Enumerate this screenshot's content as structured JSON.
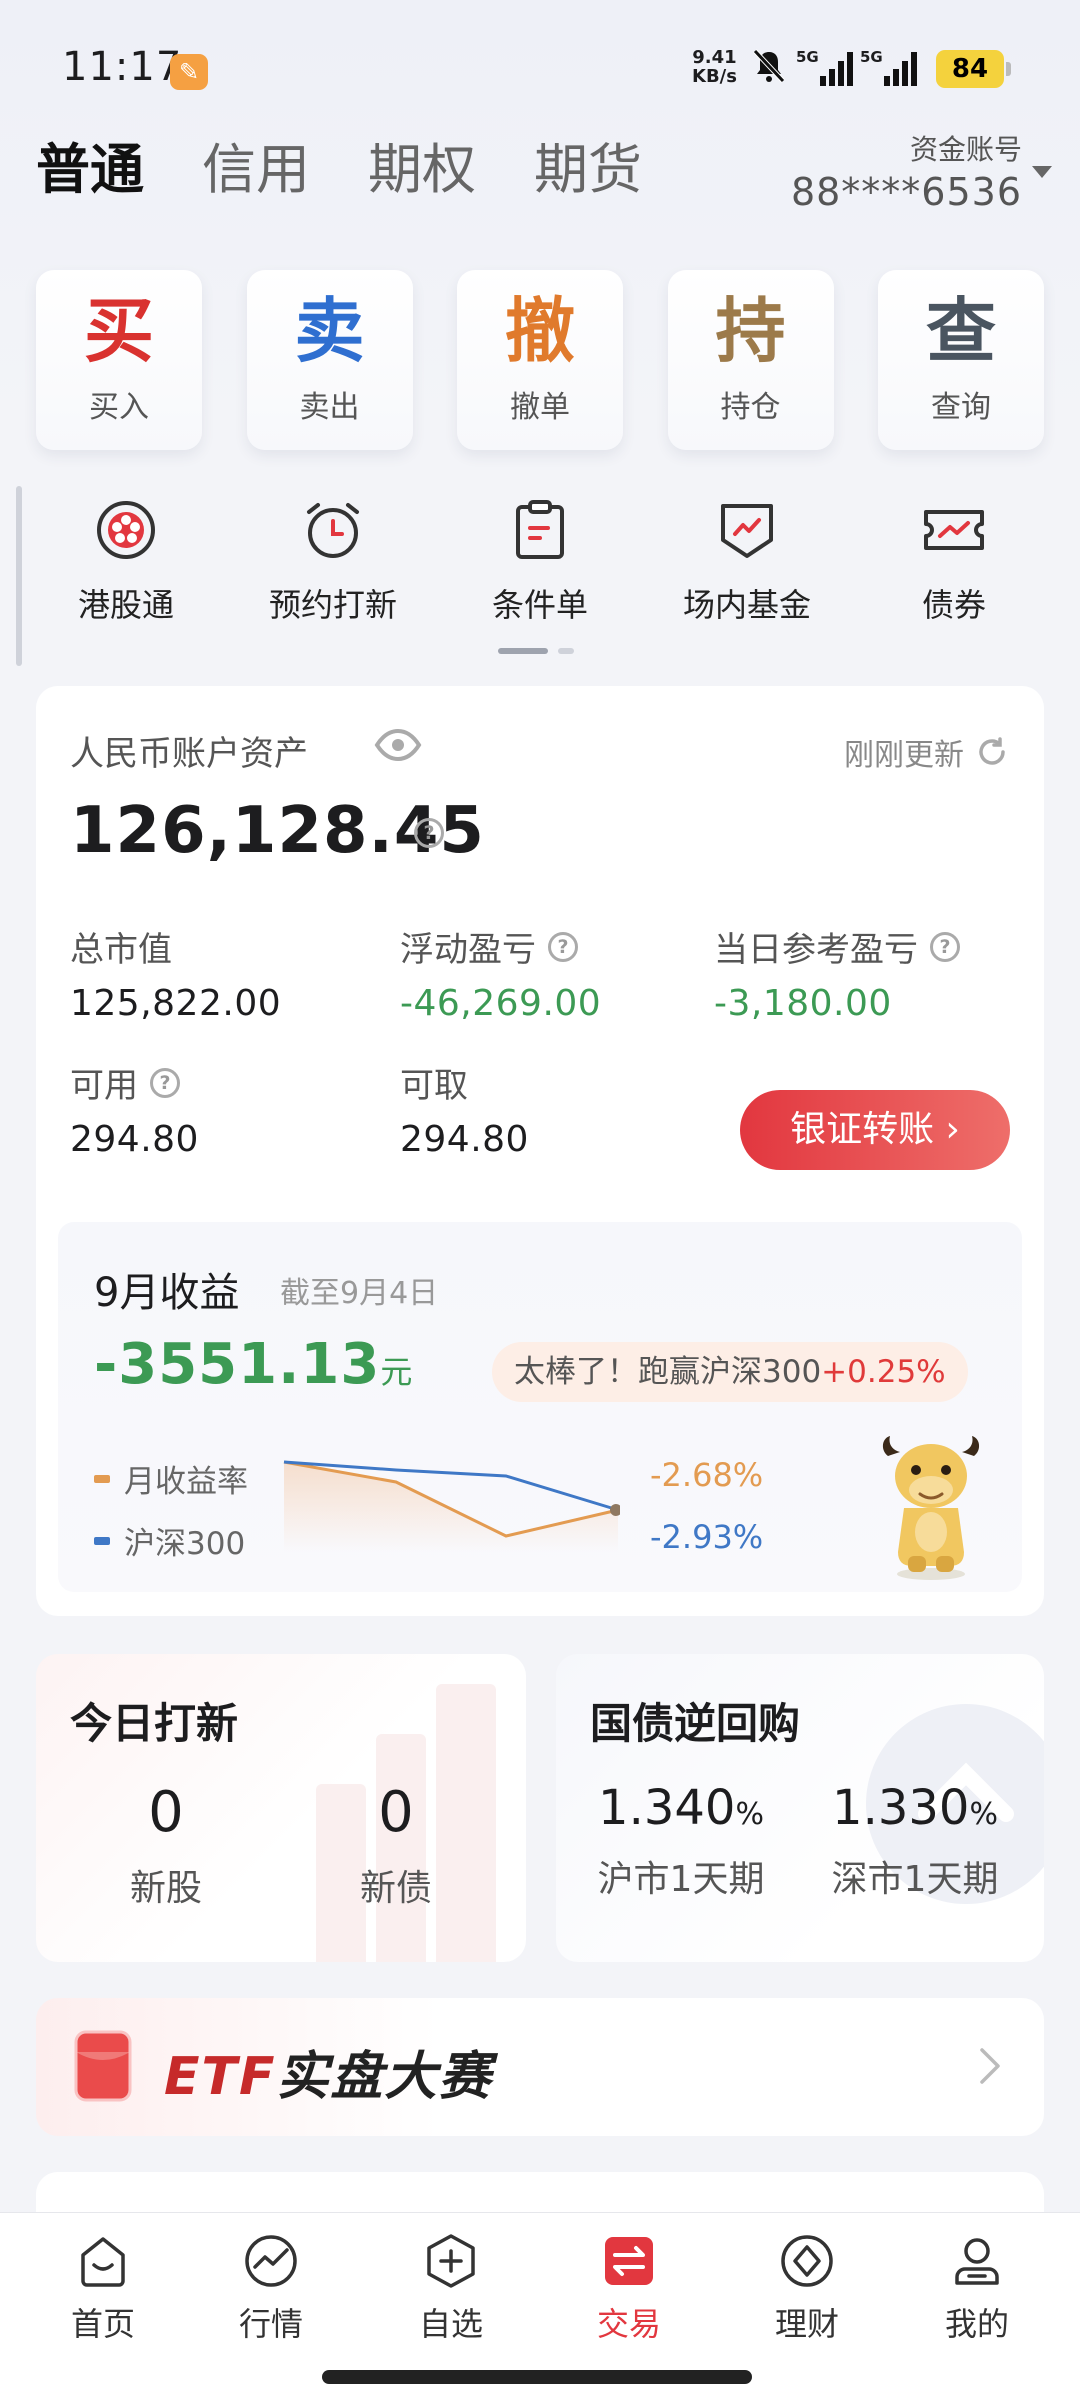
{
  "status_bar": {
    "time": "11:17",
    "app_badge_icon": "app-notification-icon",
    "net_speed_value": "9.41",
    "net_speed_unit": "KB/s",
    "sim1": "5G",
    "sim2": "5G",
    "battery": "84"
  },
  "top_tabs": [
    {
      "label": "普通",
      "active": true
    },
    {
      "label": "信用",
      "active": false
    },
    {
      "label": "期权",
      "active": false
    },
    {
      "label": "期货",
      "active": false
    }
  ],
  "account": {
    "label": "资金账号",
    "number": "88****6536"
  },
  "actions": [
    {
      "big": "买",
      "small": "买入",
      "color": "#d9322f"
    },
    {
      "big": "卖",
      "small": "卖出",
      "color": "#2f6fd0"
    },
    {
      "big": "撤",
      "small": "撤单",
      "color": "#e07a2c"
    },
    {
      "big": "持",
      "small": "持仓",
      "color": "#9c7a4a"
    },
    {
      "big": "查",
      "small": "查询",
      "color": "#4a5560"
    }
  ],
  "services": [
    {
      "label": "港股通",
      "icon": "hk-flower-icon"
    },
    {
      "label": "预约打新",
      "icon": "alarm-clock-icon"
    },
    {
      "label": "条件单",
      "icon": "clipboard-icon"
    },
    {
      "label": "场内基金",
      "icon": "fund-shield-icon"
    },
    {
      "label": "债券",
      "icon": "bond-ticket-icon"
    }
  ],
  "asset": {
    "title": "人民币账户资产",
    "updated": "刚刚更新",
    "total": "126,128.45",
    "market_value_label": "总市值",
    "market_value": "125,822.00",
    "float_pl_label": "浮动盈亏",
    "float_pl": "-46,269.00",
    "daily_pl_label": "当日参考盈亏",
    "daily_pl": "-3,180.00",
    "available_label": "可用",
    "available": "294.80",
    "withdrawable_label": "可取",
    "withdrawable": "294.80",
    "transfer_button": "银证转账 ›"
  },
  "monthly": {
    "title": "9月收益",
    "subtitle": "截至9月4日",
    "value": "-3551.13",
    "unit": "元",
    "bubble_text": "太棒了！跑赢沪深300",
    "bubble_highlight": "+0.25%",
    "series1_label": "月收益率",
    "series1_value": "-2.68%",
    "series1_color": "#e39b51",
    "series2_label": "沪深300",
    "series2_value": "-2.93%",
    "series2_color": "#3f78c6"
  },
  "ipo": {
    "title": "今日打新",
    "stocks_value": "0",
    "stocks_label": "新股",
    "bonds_value": "0",
    "bonds_label": "新债"
  },
  "repo": {
    "title": "国债逆回购",
    "sh_value": "1.340",
    "sh_unit": "%",
    "sh_label": "沪市1天期",
    "sz_value": "1.330",
    "sz_unit": "%",
    "sz_label": "深市1天期"
  },
  "banner": {
    "etf": "ETF",
    "text": "实盘大赛"
  },
  "bottom_nav": [
    {
      "label": "首页",
      "icon": "home-icon"
    },
    {
      "label": "行情",
      "icon": "market-chart-icon"
    },
    {
      "label": "自选",
      "icon": "add-watchlist-icon"
    },
    {
      "label": "交易",
      "icon": "trade-exchange-icon",
      "active": true
    },
    {
      "label": "理财",
      "icon": "wealth-icon"
    },
    {
      "label": "我的",
      "icon": "profile-icon"
    }
  ]
}
